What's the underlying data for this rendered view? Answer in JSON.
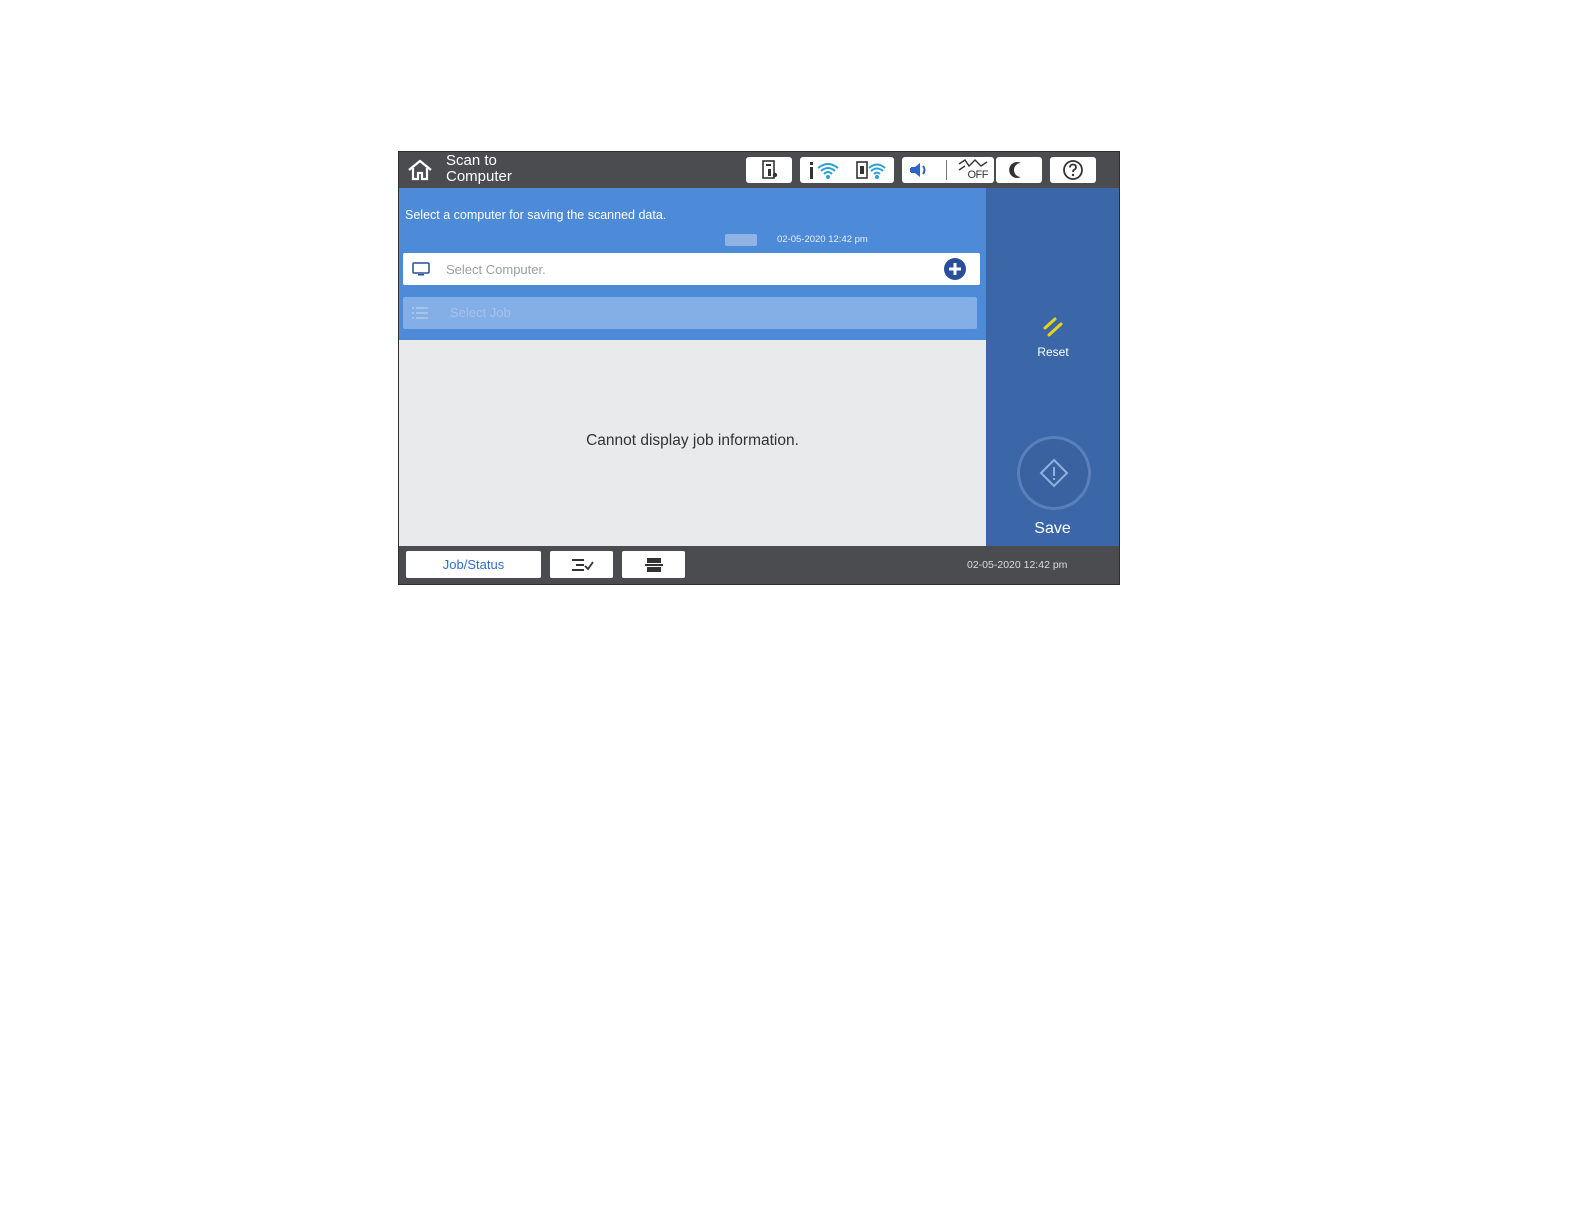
{
  "header": {
    "title_line1": "Scan to",
    "title_line2": "Computer",
    "icons": [
      "home-icon",
      "printer-status-icon",
      "wifi-icon",
      "wifi-direct-icon",
      "speaker-icon",
      "wifi-off-icon",
      "sleep-icon",
      "help-icon"
    ],
    "wifi_off_label": "OFF"
  },
  "main": {
    "instruction": "Select a computer for saving the scanned data.",
    "datetime_small": "02-05-2020 12:42 pm",
    "computer_placeholder": "Select Computer.",
    "job_placeholder": "Select Job",
    "job_message": "Cannot display job information."
  },
  "side": {
    "reset_label": "Reset",
    "save_label": "Save"
  },
  "footer": {
    "job_status_label": "Job/Status",
    "datetime": "02-05-2020 12:42 pm"
  },
  "colors": {
    "topbar": "#4a4c50",
    "content_blue": "#4d8ad8",
    "side_panel": "#3b67a8",
    "reset_accent": "#e8d31c",
    "add_icon": "#2a4f9a"
  }
}
